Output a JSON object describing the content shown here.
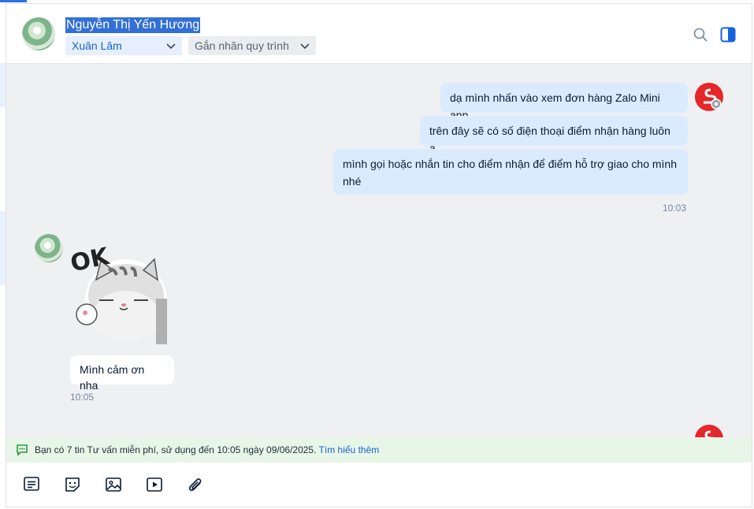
{
  "header": {
    "contact_name": "Nguyễn Thị Yến Hương",
    "assignee": "Xuân Lâm",
    "label_chip": "Gắn nhãn quy trình",
    "icons": [
      "search-icon",
      "toggle-sidebar-icon"
    ]
  },
  "messages": {
    "outgoing": [
      {
        "text": "dạ mình nhấn vào xem đơn hàng Zalo Mini app"
      },
      {
        "text": "trên đây sẽ có số điện thoại điểm nhận hàng luôn ạ"
      },
      {
        "text": "mình gọi hoặc nhắn tin cho điểm nhận để điểm hỗ trợ giao cho mình nhé"
      }
    ],
    "outgoing_time": "10:03",
    "sticker_text": "OK",
    "incoming": [
      {
        "text": "Mình cảm ơn nha"
      }
    ],
    "incoming_time": "10:05"
  },
  "notice": {
    "text": "Bạn có 7 tin Tư vấn miễn phí, sử dụng đến 10:05 ngày 09/06/2025. ",
    "link": "Tìm hiểu thêm"
  },
  "toolbar": {
    "icons": [
      "quick-message-icon",
      "sticker-icon",
      "image-icon",
      "video-icon",
      "attachment-icon"
    ]
  },
  "colors": {
    "accent": "#1463d8",
    "outgoing_bubble": "#dbebff",
    "chat_background": "#eef0f1",
    "notice_background": "#e7f6e7",
    "brand_avatar": "#e5262b"
  }
}
